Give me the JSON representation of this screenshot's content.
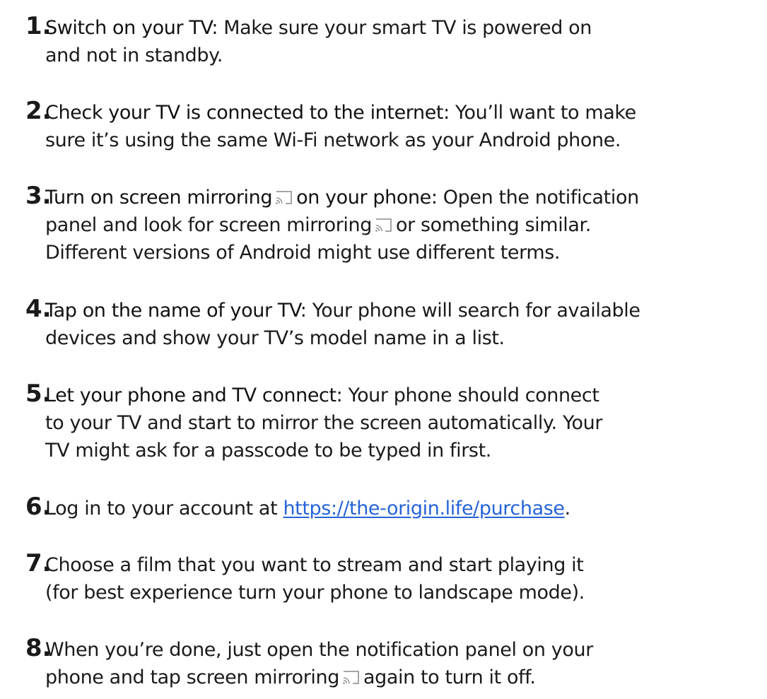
{
  "steps": [
    {
      "number": "1.",
      "heading": "Switch on your TV:",
      "line1": " Make sure your smart TV is powered on",
      "line2": "and not in standby."
    },
    {
      "number": "2.",
      "heading": "Check your TV is connected to the internet:",
      "line1": " You’ll want to make",
      "line2": "sure it’s using the same Wi-Fi network as your Android phone."
    },
    {
      "number": "3.",
      "heading_a": "Turn on screen mirroring",
      "heading_b": "on your phone:",
      "line1": " Open the notification",
      "line2_a": "panel and look for screen mirroring",
      "line2_b": "or something similar.",
      "line3": "Different versions of Android might use different terms."
    },
    {
      "number": "4.",
      "heading": "Tap on the name of your TV:",
      "line1": " Your phone will search for available",
      "line2": "devices and show your TV’s model name in a list."
    },
    {
      "number": "5.",
      "heading": "Let your phone and TV connect:",
      "line1": " Your phone should connect",
      "line2": "to your TV and start to mirror the screen automatically. Your",
      "line3": "TV might ask for a passcode to be typed in first."
    },
    {
      "number": "6.",
      "line1_a": "Log in to your account at ",
      "link": "https://the-origin.life/purchase",
      "line1_b": "."
    },
    {
      "number": "7.",
      "line1": "Choose a film that you want to stream and start playing it",
      "line2": "(for best experience turn your phone to landscape mode)."
    },
    {
      "number": "8.",
      "line1": "When you’re done, just open the notification panel on your",
      "line2_a": "phone and tap screen mirroring",
      "line2_b": "again to turn it off."
    }
  ],
  "icons": {
    "cast": "screen-mirroring-icon"
  },
  "colors": {
    "text": "#1a1a1a",
    "link": "#2563d9",
    "icon": "#9a9a9a"
  }
}
